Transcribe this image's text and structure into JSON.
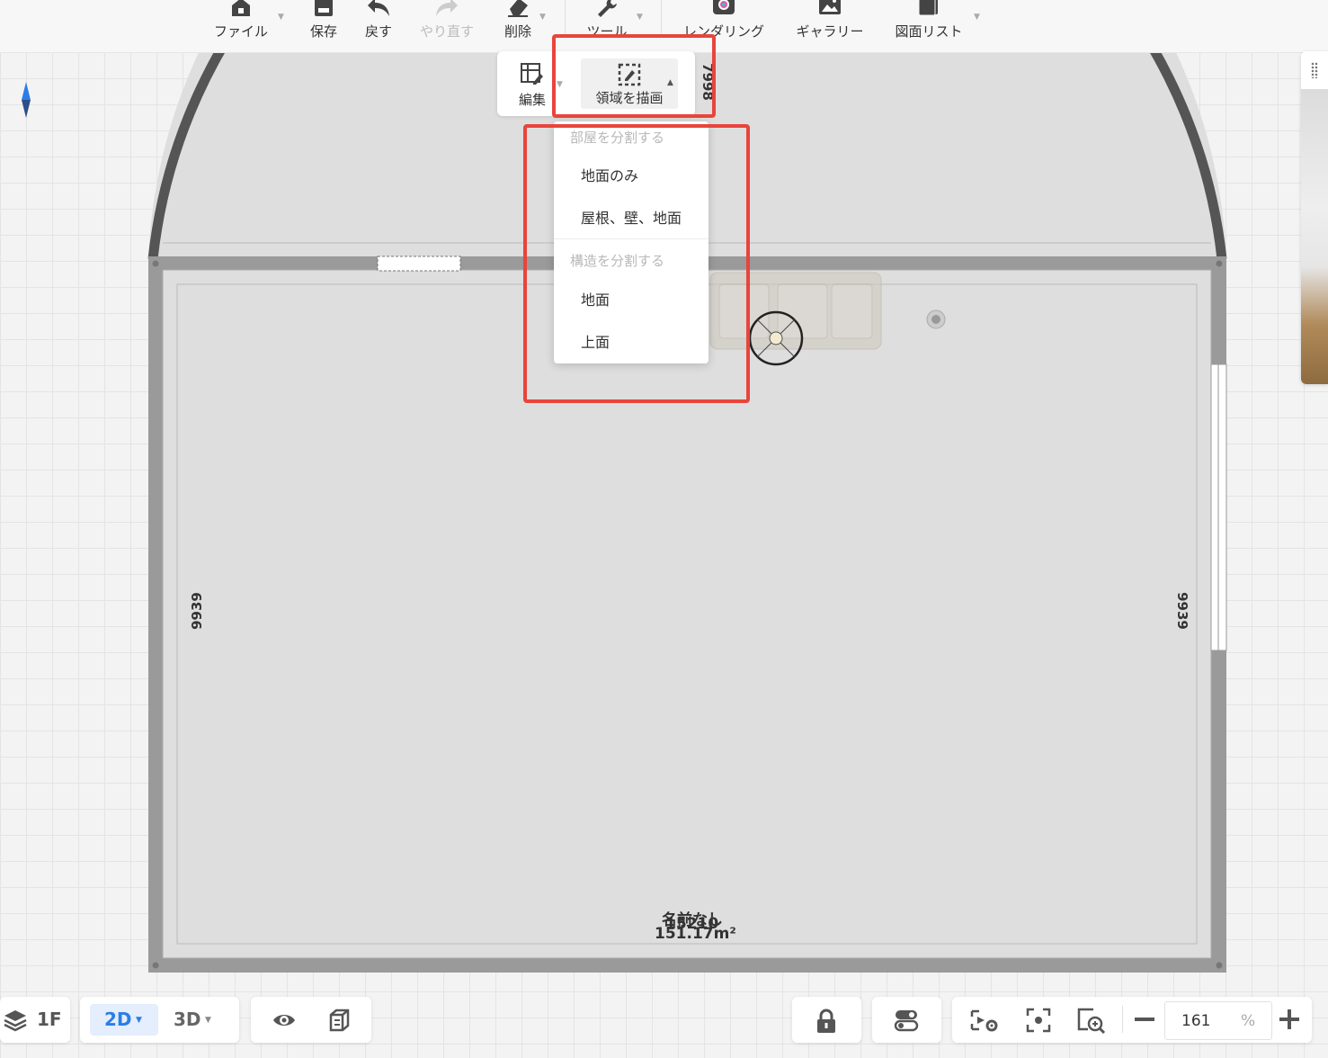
{
  "toolbar": {
    "file_label": "ファイル",
    "save_label": "保存",
    "undo_label": "戻す",
    "redo_label": "やり直す",
    "delete_label": "削除",
    "tools_label": "ツール",
    "render_label": "レンダリング",
    "gallery_label": "ギャラリー",
    "drawings_label": "図面リスト"
  },
  "subbar": {
    "edit_label": "編集",
    "draw_area_label": "領域を描画"
  },
  "dropdown": {
    "section_room": "部屋を分割する",
    "item_floor_only": "地面のみ",
    "item_roof_wall_floor": "屋根、壁、地面",
    "section_structure": "構造を分割する",
    "item_ground": "地面",
    "item_top": "上面"
  },
  "plan": {
    "dim_left": "9939",
    "dim_right": "9939",
    "dim_top_partial": "7998",
    "area_partial": "m²",
    "room_name": "名前なし",
    "dim_bottom": "15210",
    "room_area": "151.17m²"
  },
  "bottombar": {
    "floor_label": "1F",
    "view_2d": "2D",
    "view_3d": "3D",
    "zoom_value": "161",
    "zoom_unit": "%"
  },
  "colors": {
    "accent": "#2b7de9",
    "highlight": "#e8453c",
    "wall": "#9a9a9a",
    "room_fill": "#dedede"
  }
}
